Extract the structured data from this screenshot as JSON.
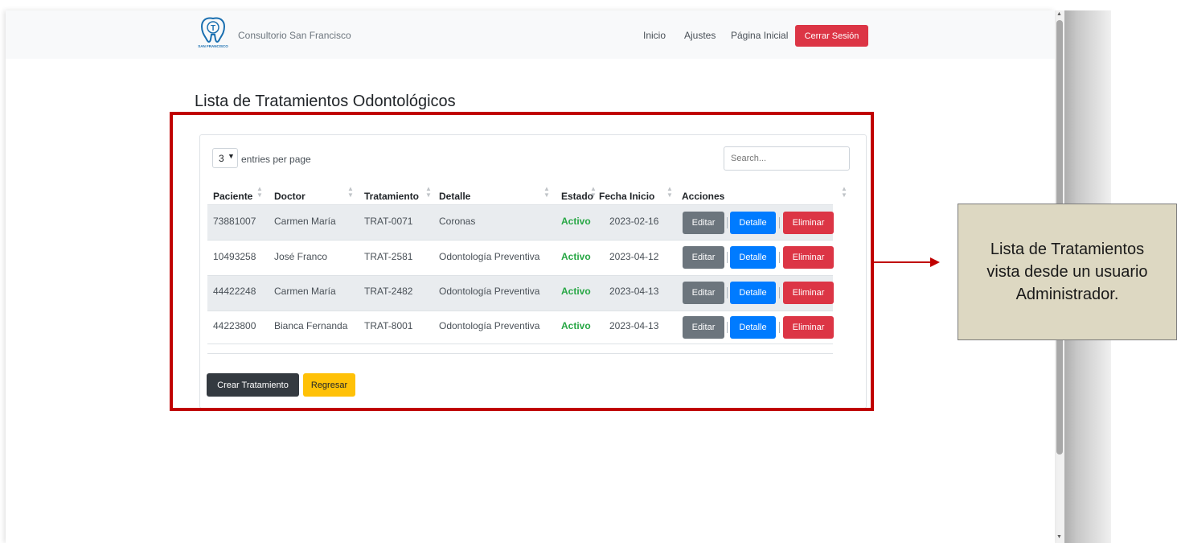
{
  "navbar": {
    "brand": "Consultorio San Francisco",
    "logo_letter": "T",
    "logo_caption": "SAN FRANCISCO",
    "links": [
      "Inicio",
      "Ajustes",
      "Página Inicial"
    ],
    "logout": "Cerrar Sesión"
  },
  "page": {
    "title": "Lista de Tratamientos Odontológicos"
  },
  "table": {
    "page_size": "3",
    "entries_label": "entries per page",
    "search_placeholder": "Search...",
    "columns": [
      "Paciente",
      "Doctor",
      "Tratamiento",
      "Detalle",
      "Estado",
      "Fecha Inicio",
      "Acciones"
    ],
    "rows": [
      {
        "paciente": "73881007",
        "doctor": "Carmen María",
        "tratamiento": "TRAT-0071",
        "detalle": "Coronas",
        "estado": "Activo",
        "fecha": "2023-02-16"
      },
      {
        "paciente": "10493258",
        "doctor": "José Franco",
        "tratamiento": "TRAT-2581",
        "detalle": "Odontología Preventiva",
        "estado": "Activo",
        "fecha": "2023-04-12"
      },
      {
        "paciente": "44422248",
        "doctor": "Carmen María",
        "tratamiento": "TRAT-2482",
        "detalle": "Odontología Preventiva",
        "estado": "Activo",
        "fecha": "2023-04-13"
      },
      {
        "paciente": "44223800",
        "doctor": "Bianca Fernanda",
        "tratamiento": "TRAT-8001",
        "detalle": "Odontología Preventiva",
        "estado": "Activo",
        "fecha": "2023-04-13"
      }
    ],
    "actions": {
      "edit": "Editar",
      "detail": "Detalle",
      "delete": "Eliminar"
    }
  },
  "footer_buttons": {
    "create": "Crear Tratamiento",
    "back": "Regresar"
  },
  "callout": {
    "text": "Lista de Tratamientos vista desde un usuario Administrador."
  },
  "colors": {
    "highlight": "#c00000",
    "danger": "#dc3545",
    "primary": "#007bff",
    "secondary": "#6c757d",
    "warning": "#ffc107",
    "dark": "#343a40",
    "success": "#28a745",
    "callout_bg": "#ddd8c2"
  }
}
